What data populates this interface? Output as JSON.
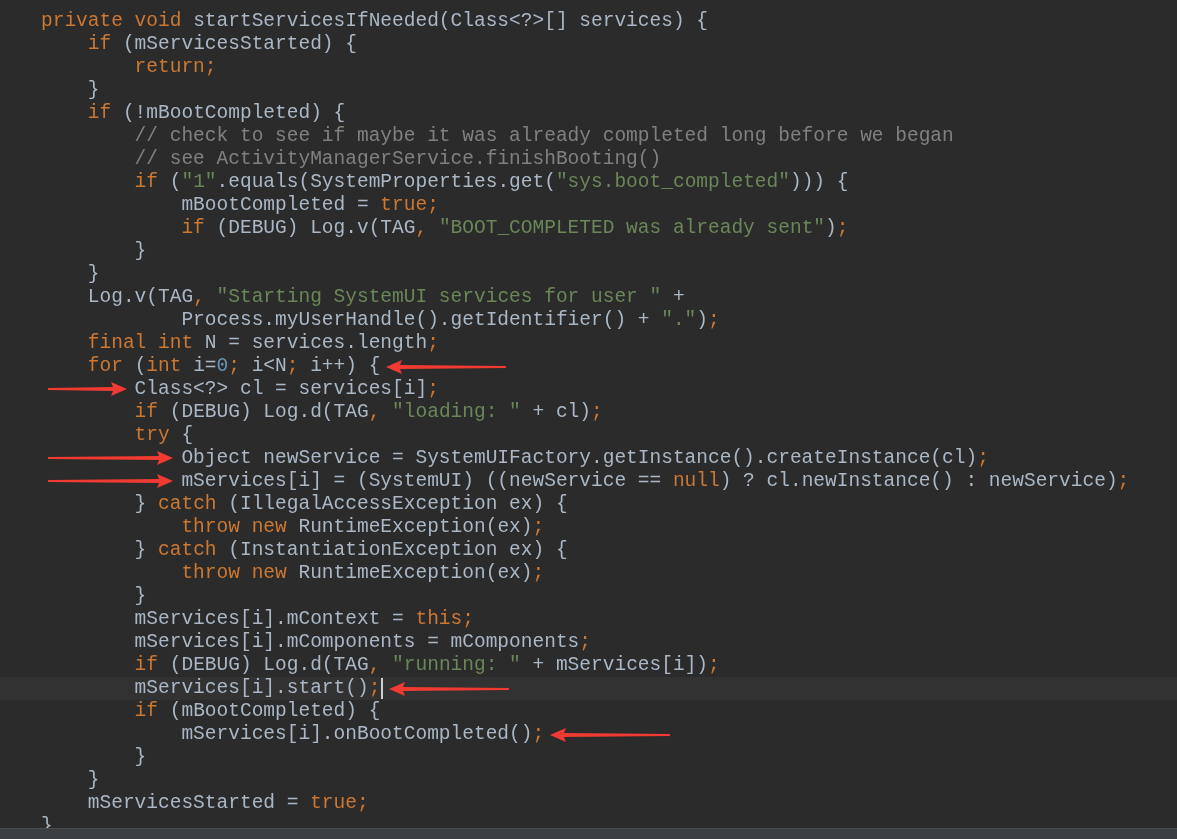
{
  "editor": {
    "lines": [
      {
        "current": false,
        "arrow_before": false,
        "arrow_after": false,
        "tokens": [
          {
            "kind": "keyword",
            "text": "private void "
          },
          {
            "kind": "plain",
            "text": "startServicesIfNeeded(Class<?>[] services) {"
          }
        ]
      },
      {
        "current": false,
        "arrow_before": false,
        "arrow_after": false,
        "tokens": [
          {
            "kind": "keyword",
            "text": "    if "
          },
          {
            "kind": "plain",
            "text": "(mServicesStarted) {"
          }
        ]
      },
      {
        "current": false,
        "arrow_before": false,
        "arrow_after": false,
        "tokens": [
          {
            "kind": "keyword",
            "text": "        return;"
          }
        ]
      },
      {
        "current": false,
        "arrow_before": false,
        "arrow_after": false,
        "tokens": [
          {
            "kind": "plain",
            "text": "    }"
          }
        ]
      },
      {
        "current": false,
        "arrow_before": false,
        "arrow_after": false,
        "tokens": [
          {
            "kind": "keyword",
            "text": "    if "
          },
          {
            "kind": "plain",
            "text": "(!mBootCompleted) {"
          }
        ]
      },
      {
        "current": false,
        "arrow_before": false,
        "arrow_after": false,
        "tokens": [
          {
            "kind": "comment",
            "text": "        // check to see if maybe it was already completed long before we began"
          }
        ]
      },
      {
        "current": false,
        "arrow_before": false,
        "arrow_after": false,
        "tokens": [
          {
            "kind": "comment",
            "text": "        // see ActivityManagerService.finishBooting()"
          }
        ]
      },
      {
        "current": false,
        "arrow_before": false,
        "arrow_after": false,
        "tokens": [
          {
            "kind": "keyword",
            "text": "        if "
          },
          {
            "kind": "plain",
            "text": "("
          },
          {
            "kind": "string",
            "text": "\"1\""
          },
          {
            "kind": "plain",
            "text": ".equals(SystemProperties.get("
          },
          {
            "kind": "string",
            "text": "\"sys.boot_completed\""
          },
          {
            "kind": "plain",
            "text": "))) {"
          }
        ]
      },
      {
        "current": false,
        "arrow_before": false,
        "arrow_after": false,
        "tokens": [
          {
            "kind": "plain",
            "text": "            mBootCompleted = "
          },
          {
            "kind": "keyword",
            "text": "true;"
          }
        ]
      },
      {
        "current": false,
        "arrow_before": false,
        "arrow_after": false,
        "tokens": [
          {
            "kind": "keyword",
            "text": "            if "
          },
          {
            "kind": "plain",
            "text": "(DEBUG) Log.v(TAG"
          },
          {
            "kind": "keyword",
            "text": ", "
          },
          {
            "kind": "string",
            "text": "\"BOOT_COMPLETED was already sent\""
          },
          {
            "kind": "plain",
            "text": ")"
          },
          {
            "kind": "keyword",
            "text": ";"
          }
        ]
      },
      {
        "current": false,
        "arrow_before": false,
        "arrow_after": false,
        "tokens": [
          {
            "kind": "plain",
            "text": "        }"
          }
        ]
      },
      {
        "current": false,
        "arrow_before": false,
        "arrow_after": false,
        "tokens": [
          {
            "kind": "plain",
            "text": "    }"
          }
        ]
      },
      {
        "current": false,
        "arrow_before": false,
        "arrow_after": false,
        "tokens": [
          {
            "kind": "plain",
            "text": "    Log.v(TAG"
          },
          {
            "kind": "keyword",
            "text": ", "
          },
          {
            "kind": "string",
            "text": "\"Starting SystemUI services for user \""
          },
          {
            "kind": "plain",
            "text": " +"
          }
        ]
      },
      {
        "current": false,
        "arrow_before": false,
        "arrow_after": false,
        "tokens": [
          {
            "kind": "plain",
            "text": "            Process.myUserHandle().getIdentifier() + "
          },
          {
            "kind": "string",
            "text": "\".\""
          },
          {
            "kind": "plain",
            "text": ")"
          },
          {
            "kind": "keyword",
            "text": ";"
          }
        ]
      },
      {
        "current": false,
        "arrow_before": false,
        "arrow_after": false,
        "tokens": [
          {
            "kind": "keyword",
            "text": "    final int "
          },
          {
            "kind": "plain",
            "text": "N = services.length"
          },
          {
            "kind": "keyword",
            "text": ";"
          }
        ]
      },
      {
        "current": false,
        "arrow_before": false,
        "arrow_after": true,
        "tokens": [
          {
            "kind": "keyword",
            "text": "    for "
          },
          {
            "kind": "plain",
            "text": "("
          },
          {
            "kind": "keyword",
            "text": "int "
          },
          {
            "kind": "plain",
            "text": "i="
          },
          {
            "kind": "number",
            "text": "0"
          },
          {
            "kind": "keyword",
            "text": "; "
          },
          {
            "kind": "plain",
            "text": "i<N"
          },
          {
            "kind": "keyword",
            "text": "; "
          },
          {
            "kind": "plain",
            "text": "i++) {"
          }
        ]
      },
      {
        "current": false,
        "arrow_before": true,
        "arrow_after": false,
        "tokens": [
          {
            "kind": "plain",
            "text": "        Class<?> cl = services[i]"
          },
          {
            "kind": "keyword",
            "text": ";"
          }
        ]
      },
      {
        "current": false,
        "arrow_before": false,
        "arrow_after": false,
        "tokens": [
          {
            "kind": "keyword",
            "text": "        if "
          },
          {
            "kind": "plain",
            "text": "(DEBUG) Log.d(TAG"
          },
          {
            "kind": "keyword",
            "text": ", "
          },
          {
            "kind": "string",
            "text": "\"loading: \""
          },
          {
            "kind": "plain",
            "text": " + cl)"
          },
          {
            "kind": "keyword",
            "text": ";"
          }
        ]
      },
      {
        "current": false,
        "arrow_before": false,
        "arrow_after": false,
        "tokens": [
          {
            "kind": "keyword",
            "text": "        try "
          },
          {
            "kind": "plain",
            "text": "{"
          }
        ]
      },
      {
        "current": false,
        "arrow_before": true,
        "arrow_after": false,
        "tokens": [
          {
            "kind": "plain",
            "text": "            Object newService = SystemUIFactory.getInstance().createInstance(cl)"
          },
          {
            "kind": "keyword",
            "text": ";"
          }
        ]
      },
      {
        "current": false,
        "arrow_before": true,
        "arrow_after": false,
        "tokens": [
          {
            "kind": "plain",
            "text": "            mServices[i] = (SystemUI) ((newService == "
          },
          {
            "kind": "keyword",
            "text": "null"
          },
          {
            "kind": "plain",
            "text": ") ? cl.newInstance() : newService)"
          },
          {
            "kind": "keyword",
            "text": ";"
          }
        ]
      },
      {
        "current": false,
        "arrow_before": false,
        "arrow_after": false,
        "tokens": [
          {
            "kind": "plain",
            "text": "        } "
          },
          {
            "kind": "keyword",
            "text": "catch "
          },
          {
            "kind": "plain",
            "text": "(IllegalAccessException ex) {"
          }
        ]
      },
      {
        "current": false,
        "arrow_before": false,
        "arrow_after": false,
        "tokens": [
          {
            "kind": "keyword",
            "text": "            throw new "
          },
          {
            "kind": "plain",
            "text": "RuntimeException(ex)"
          },
          {
            "kind": "keyword",
            "text": ";"
          }
        ]
      },
      {
        "current": false,
        "arrow_before": false,
        "arrow_after": false,
        "tokens": [
          {
            "kind": "plain",
            "text": "        } "
          },
          {
            "kind": "keyword",
            "text": "catch "
          },
          {
            "kind": "plain",
            "text": "(InstantiationException ex) {"
          }
        ]
      },
      {
        "current": false,
        "arrow_before": false,
        "arrow_after": false,
        "tokens": [
          {
            "kind": "keyword",
            "text": "            throw new "
          },
          {
            "kind": "plain",
            "text": "RuntimeException(ex)"
          },
          {
            "kind": "keyword",
            "text": ";"
          }
        ]
      },
      {
        "current": false,
        "arrow_before": false,
        "arrow_after": false,
        "tokens": [
          {
            "kind": "plain",
            "text": "        }"
          }
        ]
      },
      {
        "current": false,
        "arrow_before": false,
        "arrow_after": false,
        "tokens": [
          {
            "kind": "plain",
            "text": "        mServices[i].mContext = "
          },
          {
            "kind": "keyword",
            "text": "this;"
          }
        ]
      },
      {
        "current": false,
        "arrow_before": false,
        "arrow_after": false,
        "tokens": [
          {
            "kind": "plain",
            "text": "        mServices[i].mComponents = mComponents"
          },
          {
            "kind": "keyword",
            "text": ";"
          }
        ]
      },
      {
        "current": false,
        "arrow_before": false,
        "arrow_after": false,
        "tokens": [
          {
            "kind": "keyword",
            "text": "        if "
          },
          {
            "kind": "plain",
            "text": "(DEBUG) Log.d(TAG"
          },
          {
            "kind": "keyword",
            "text": ", "
          },
          {
            "kind": "string",
            "text": "\"running: \""
          },
          {
            "kind": "plain",
            "text": " + mServices[i])"
          },
          {
            "kind": "keyword",
            "text": ";"
          }
        ]
      },
      {
        "current": true,
        "arrow_before": false,
        "arrow_after": true,
        "tokens": [
          {
            "kind": "plain",
            "text": "        mServices[i].start()"
          },
          {
            "kind": "keyword",
            "text": ";"
          }
        ]
      },
      {
        "current": false,
        "arrow_before": false,
        "arrow_after": false,
        "tokens": [
          {
            "kind": "keyword",
            "text": "        if "
          },
          {
            "kind": "plain",
            "text": "(mBootCompleted) {"
          }
        ]
      },
      {
        "current": false,
        "arrow_before": false,
        "arrow_after": true,
        "tokens": [
          {
            "kind": "plain",
            "text": "            mServices[i].onBootCompleted()"
          },
          {
            "kind": "keyword",
            "text": ";"
          }
        ]
      },
      {
        "current": false,
        "arrow_before": false,
        "arrow_after": false,
        "tokens": [
          {
            "kind": "plain",
            "text": "        }"
          }
        ]
      },
      {
        "current": false,
        "arrow_before": false,
        "arrow_after": false,
        "tokens": [
          {
            "kind": "plain",
            "text": "    }"
          }
        ]
      },
      {
        "current": false,
        "arrow_before": false,
        "arrow_after": false,
        "tokens": [
          {
            "kind": "plain",
            "text": "    mServicesStarted = "
          },
          {
            "kind": "keyword",
            "text": "true;"
          }
        ]
      },
      {
        "current": false,
        "arrow_before": false,
        "arrow_after": false,
        "tokens": [
          {
            "kind": "plain",
            "text": "}"
          }
        ]
      }
    ]
  }
}
